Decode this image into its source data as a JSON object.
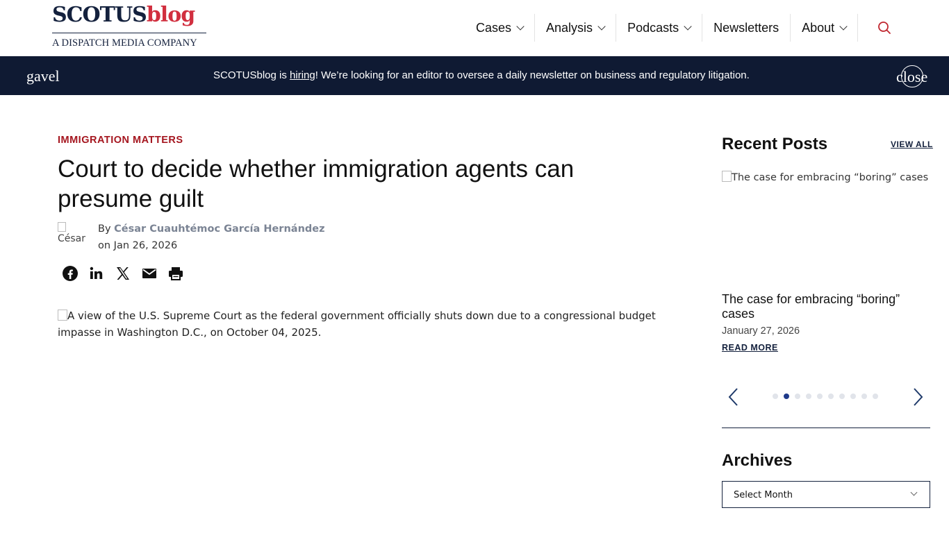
{
  "header": {
    "logo": {
      "part1": "SCOTUS",
      "part2": "blog",
      "tagline": "A DISPATCH MEDIA COMPANY"
    },
    "nav": [
      {
        "label": "Cases",
        "has_dropdown": true
      },
      {
        "label": "Analysis",
        "has_dropdown": true
      },
      {
        "label": "Podcasts",
        "has_dropdown": true
      },
      {
        "label": "Newsletters",
        "has_dropdown": false
      },
      {
        "label": "About",
        "has_dropdown": true
      }
    ],
    "search_icon": "search-icon"
  },
  "announcement": {
    "icon_alt": "gavel",
    "text_before": "SCOTUSblog is ",
    "link": "hiring",
    "text_after": "! We’re looking for an editor to oversee a daily newsletter on business and regulatory litigation.",
    "close_label": "close"
  },
  "article": {
    "category": "IMMIGRATION MATTERS",
    "title": "Court to decide whether immigration agents can presume guilt",
    "avatar_alt": "César",
    "by_prefix": "By ",
    "author": "César Cuauhtémoc García Hernández",
    "date_line": "on Jan 26, 2026",
    "share_icons": [
      "facebook-icon",
      "linkedin-icon",
      "x-icon",
      "email-icon",
      "print-icon"
    ],
    "hero_alt": "A view of the U.S. Supreme Court as the federal government officially shuts down due to a congressional budget impasse in Washington D.C., on October 04, 2025."
  },
  "sidebar": {
    "recent_heading": "Recent Posts",
    "view_all": "VIEW ALL",
    "post": {
      "image_alt": "The case for embracing “boring” cases",
      "title": "The case for embracing “boring” cases",
      "date": "January 27, 2026",
      "read_more": "READ MORE"
    },
    "carousel": {
      "dot_count": 10,
      "active_index": 1
    },
    "archives_heading": "Archives",
    "archives_select": "Select Month"
  },
  "colors": {
    "navy": "#0f1a33",
    "brand_red": "#d12f3f",
    "category_red": "#a5161f",
    "accent_blue": "#1f3a8a"
  }
}
